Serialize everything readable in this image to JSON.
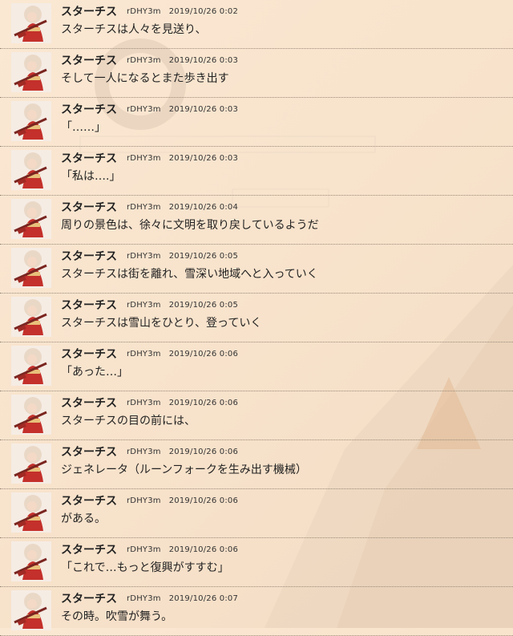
{
  "messages": [
    {
      "name": "スターチス",
      "user_id": "rDHY3m",
      "time": "2019/10/26 0:02",
      "text": "スターチスは人々を見送り、"
    },
    {
      "name": "スターチス",
      "user_id": "rDHY3m",
      "time": "2019/10/26 0:03",
      "text": "そして一人になるとまた歩き出す"
    },
    {
      "name": "スターチス",
      "user_id": "rDHY3m",
      "time": "2019/10/26 0:03",
      "text": "「……」"
    },
    {
      "name": "スターチス",
      "user_id": "rDHY3m",
      "time": "2019/10/26 0:03",
      "text": "「私は….」"
    },
    {
      "name": "スターチス",
      "user_id": "rDHY3m",
      "time": "2019/10/26 0:04",
      "text": "周りの景色は、徐々に文明を取り戻しているようだ"
    },
    {
      "name": "スターチス",
      "user_id": "rDHY3m",
      "time": "2019/10/26 0:05",
      "text": "スターチスは街を離れ、雪深い地域へと入っていく"
    },
    {
      "name": "スターチス",
      "user_id": "rDHY3m",
      "time": "2019/10/26 0:05",
      "text": "スターチスは雪山をひとり、登っていく"
    },
    {
      "name": "スターチス",
      "user_id": "rDHY3m",
      "time": "2019/10/26 0:06",
      "text": "「あった…」"
    },
    {
      "name": "スターチス",
      "user_id": "rDHY3m",
      "time": "2019/10/26 0:06",
      "text": "スターチスの目の前には、"
    },
    {
      "name": "スターチス",
      "user_id": "rDHY3m",
      "time": "2019/10/26 0:06",
      "text": "ジェネレータ（ルーンフォークを生み出す機械）"
    },
    {
      "name": "スターチス",
      "user_id": "rDHY3m",
      "time": "2019/10/26 0:06",
      "text": "がある。"
    },
    {
      "name": "スターチス",
      "user_id": "rDHY3m",
      "time": "2019/10/26 0:06",
      "text": "「これで…もっと復興がすすむ」"
    },
    {
      "name": "スターチス",
      "user_id": "rDHY3m",
      "time": "2019/10/26 0:07",
      "text": "その時。吹雪が舞う。"
    }
  ],
  "avatar_icon": "character-portrait",
  "colors": {
    "background": "#fbe8d3",
    "text": "#222222",
    "divider": "#9a8a7a",
    "avatar_hair": "#e9d7c4",
    "avatar_dress": "#c4302b"
  }
}
